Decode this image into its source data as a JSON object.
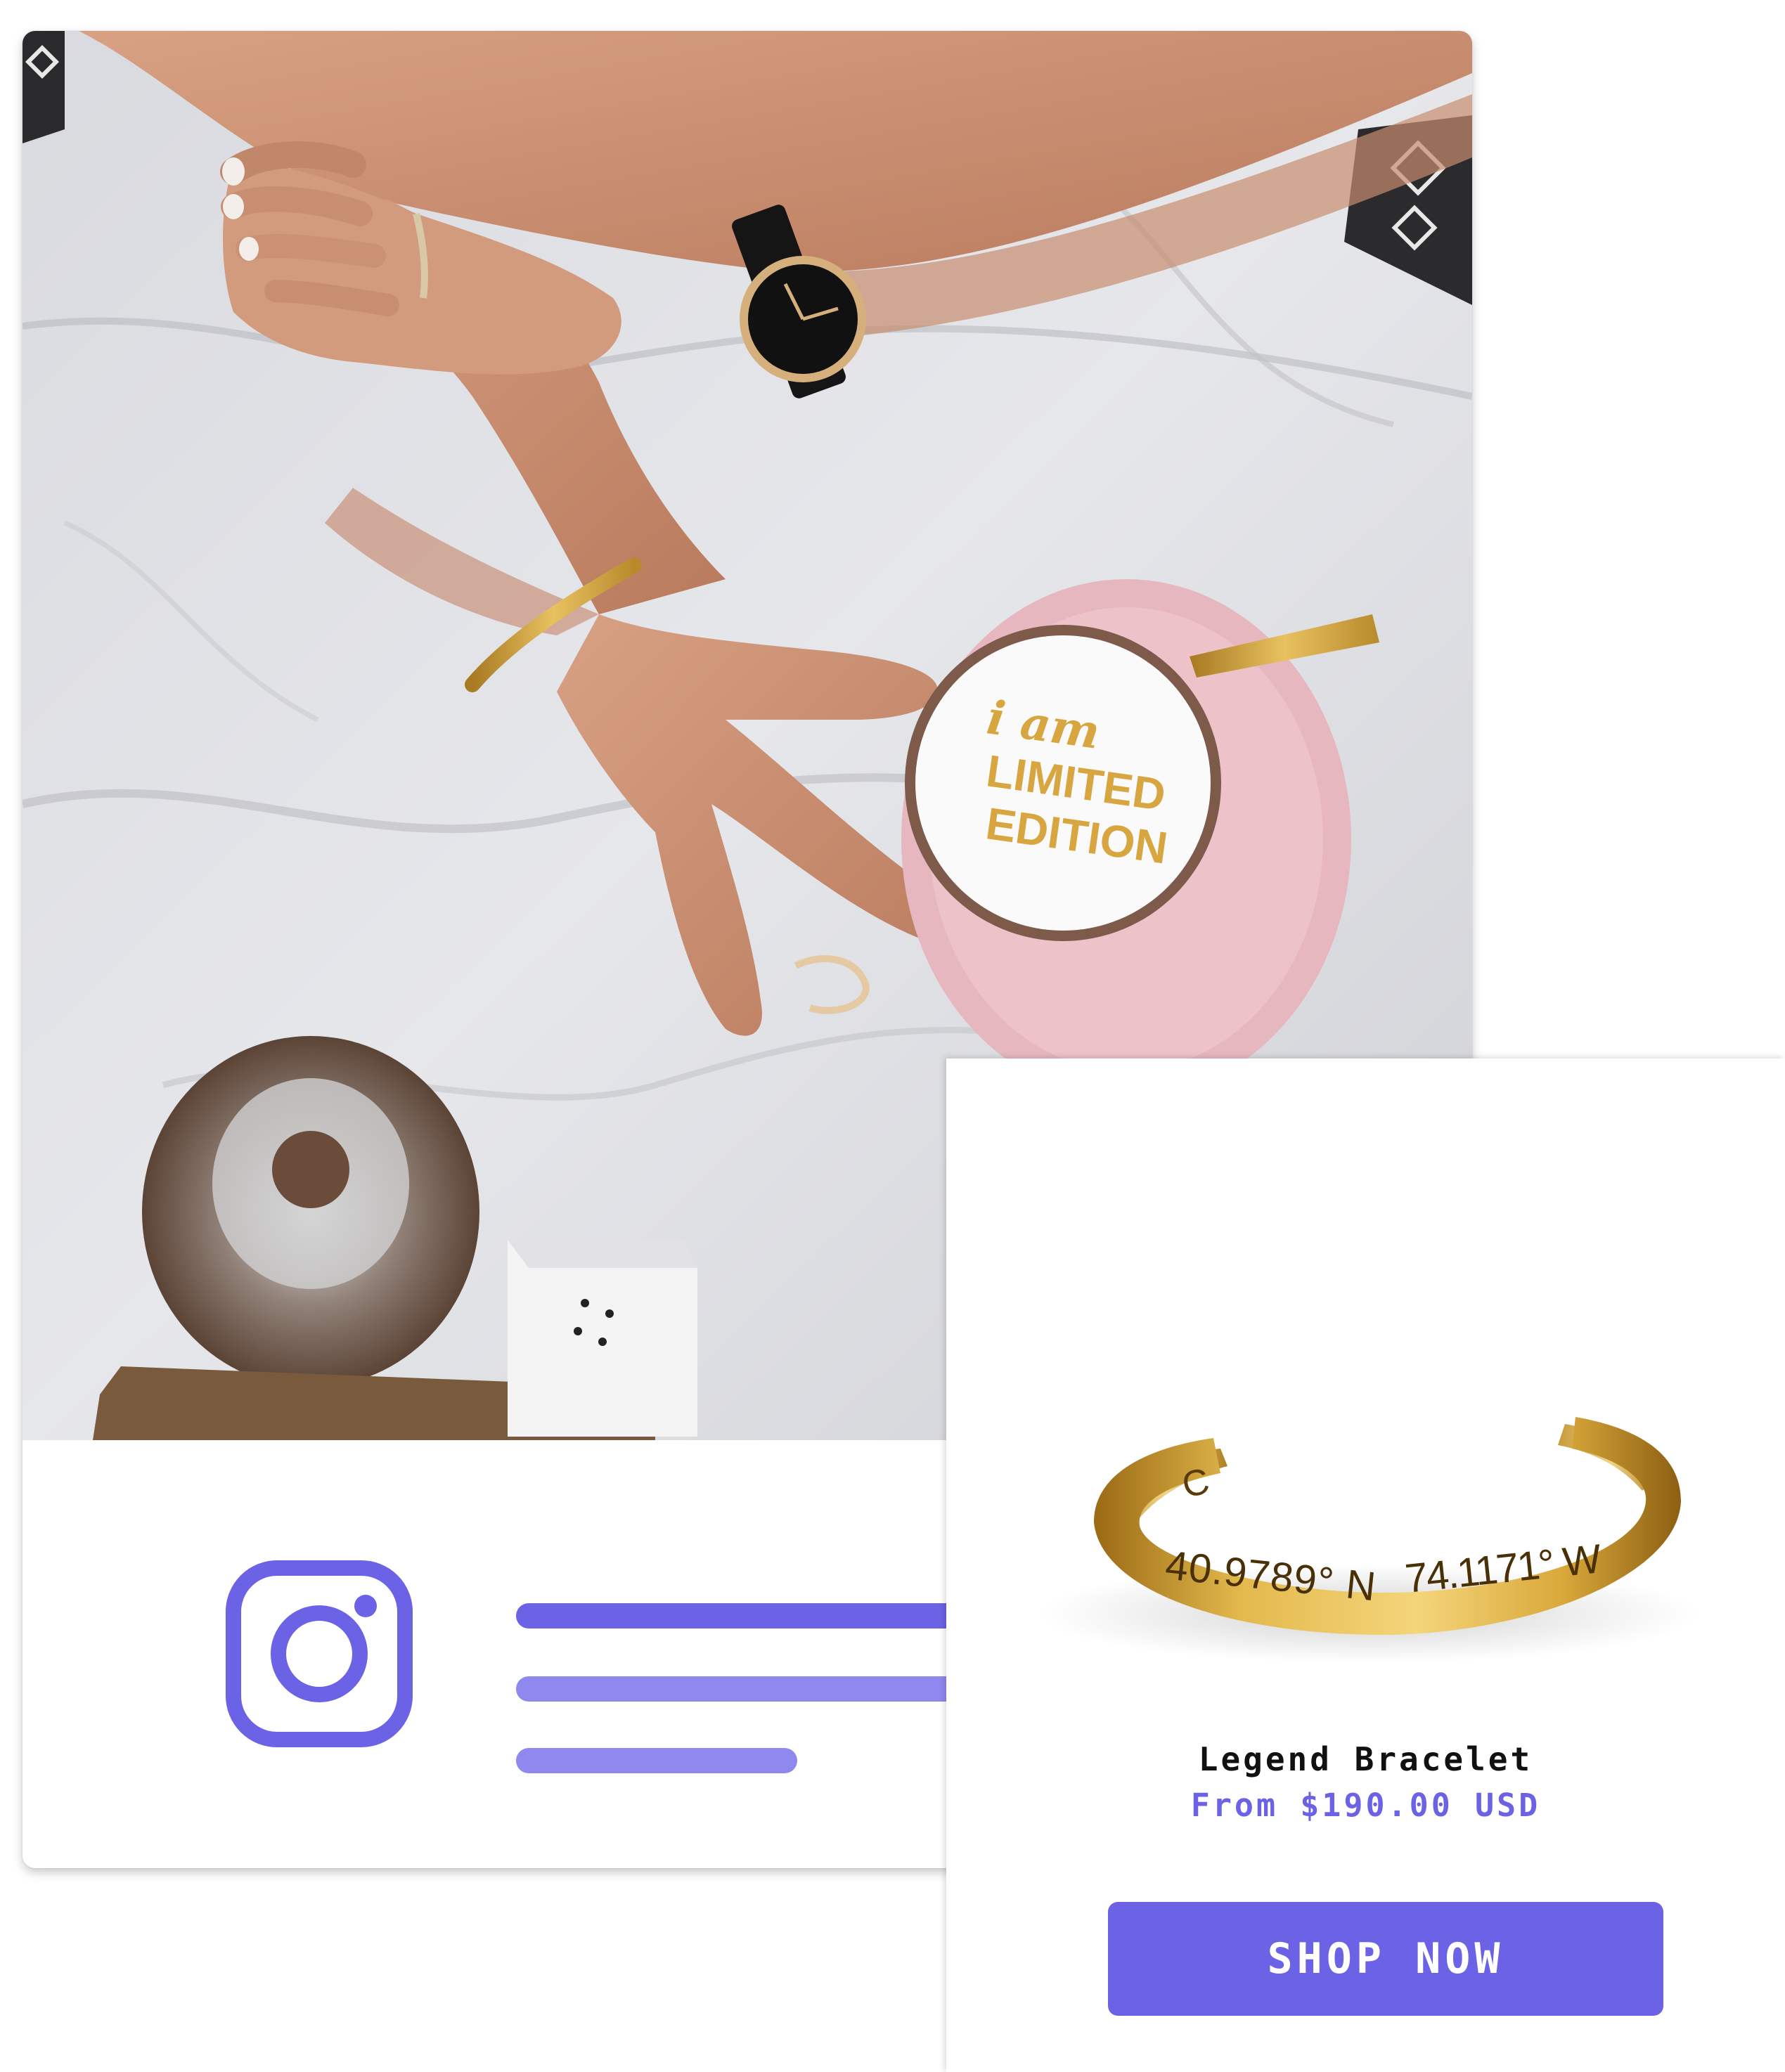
{
  "post": {
    "photo_alt": "Arms resting on a marble table with a watch, gold cuff bracelet and a coffee cup",
    "cup_text": {
      "line1": "i am",
      "line2": "LIMITED",
      "line3": "EDITION"
    },
    "icon": "instagram-icon"
  },
  "product": {
    "name": "Legend Bracelet",
    "price": "From $190.00 USD",
    "engraving": {
      "left": "40.9789° N",
      "right": "74.1171° W",
      "inner": "C"
    },
    "button_label": "SHOP NOW"
  },
  "colors": {
    "accent": "#6B62E6",
    "accent_light": "#8F88EE",
    "text_dark": "#111111",
    "gold": "#D4A33A"
  }
}
